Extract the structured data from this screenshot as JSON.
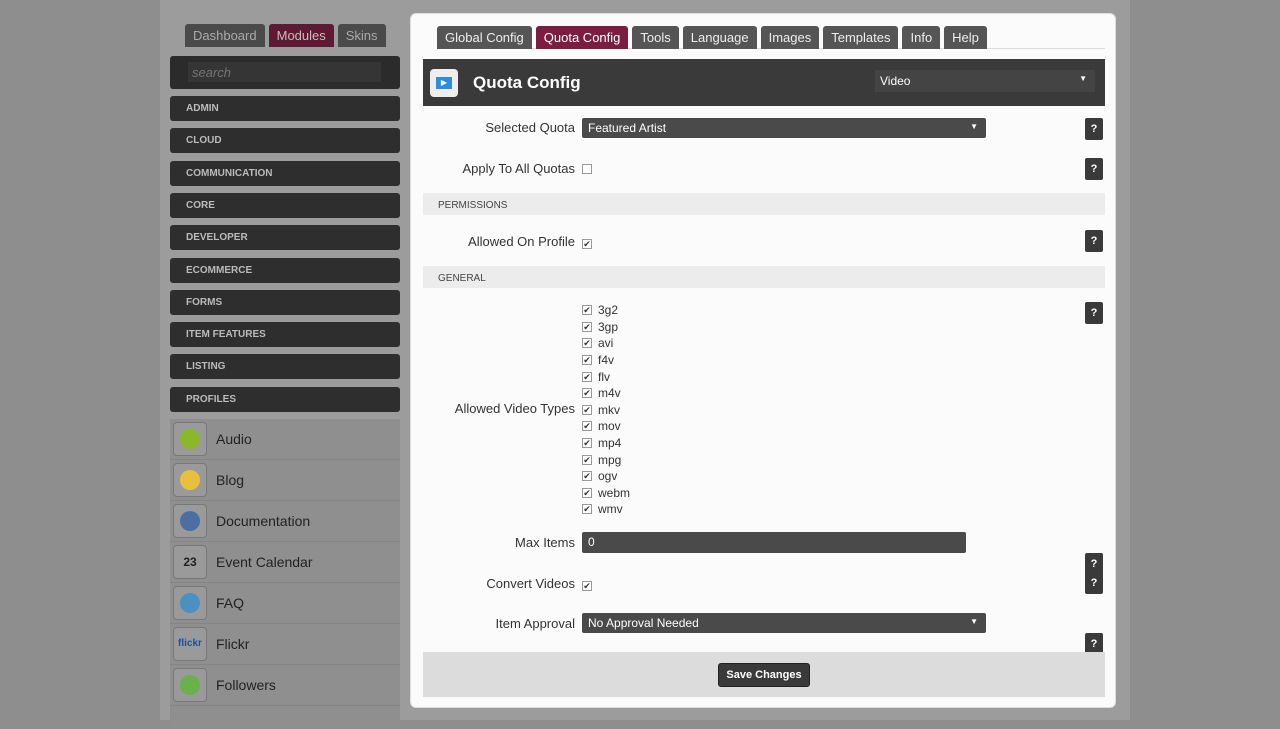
{
  "sidebar": {
    "tabs": [
      "Dashboard",
      "Modules",
      "Skins"
    ],
    "search_placeholder": "search",
    "categories": [
      "ADMIN",
      "CLOUD",
      "COMMUNICATION",
      "CORE",
      "DEVELOPER",
      "ECOMMERCE",
      "FORMS",
      "ITEM FEATURES",
      "LISTING",
      "PROFILES"
    ],
    "modules": [
      {
        "label": "Audio",
        "icon": "play-icon"
      },
      {
        "label": "Blog",
        "icon": "pencil-icon"
      },
      {
        "label": "Documentation",
        "icon": "book-icon"
      },
      {
        "label": "Event Calendar",
        "icon": "calendar-icon",
        "icon_text": "23"
      },
      {
        "label": "FAQ",
        "icon": "question-bubble-icon"
      },
      {
        "label": "Flickr",
        "icon": "flickr-icon",
        "icon_text": "flickr"
      },
      {
        "label": "Followers",
        "icon": "followers-icon"
      }
    ]
  },
  "main": {
    "tabs": [
      "Global Config",
      "Quota Config",
      "Tools",
      "Language",
      "Images",
      "Templates",
      "Info",
      "Help"
    ],
    "title": "Quota Config",
    "type_select": "Video",
    "selected_quota_label": "Selected Quota",
    "selected_quota": "Featured Artist",
    "apply_all_label": "Apply To All Quotas",
    "permissions": "PERMISSIONS",
    "allowed_profile_label": "Allowed On Profile",
    "general": "GENERAL",
    "video_types_label": "Allowed Video Types",
    "video_types": [
      "3g2",
      "3gp",
      "avi",
      "f4v",
      "flv",
      "m4v",
      "mkv",
      "mov",
      "mp4",
      "mpg",
      "ogv",
      "webm",
      "wmv"
    ],
    "max_items_label": "Max Items",
    "max_items": "0",
    "convert_label": "Convert Videos",
    "approval_label": "Item Approval",
    "approval": "No Approval Needed",
    "help": "?",
    "save": "Save Changes",
    "check": "✔"
  }
}
